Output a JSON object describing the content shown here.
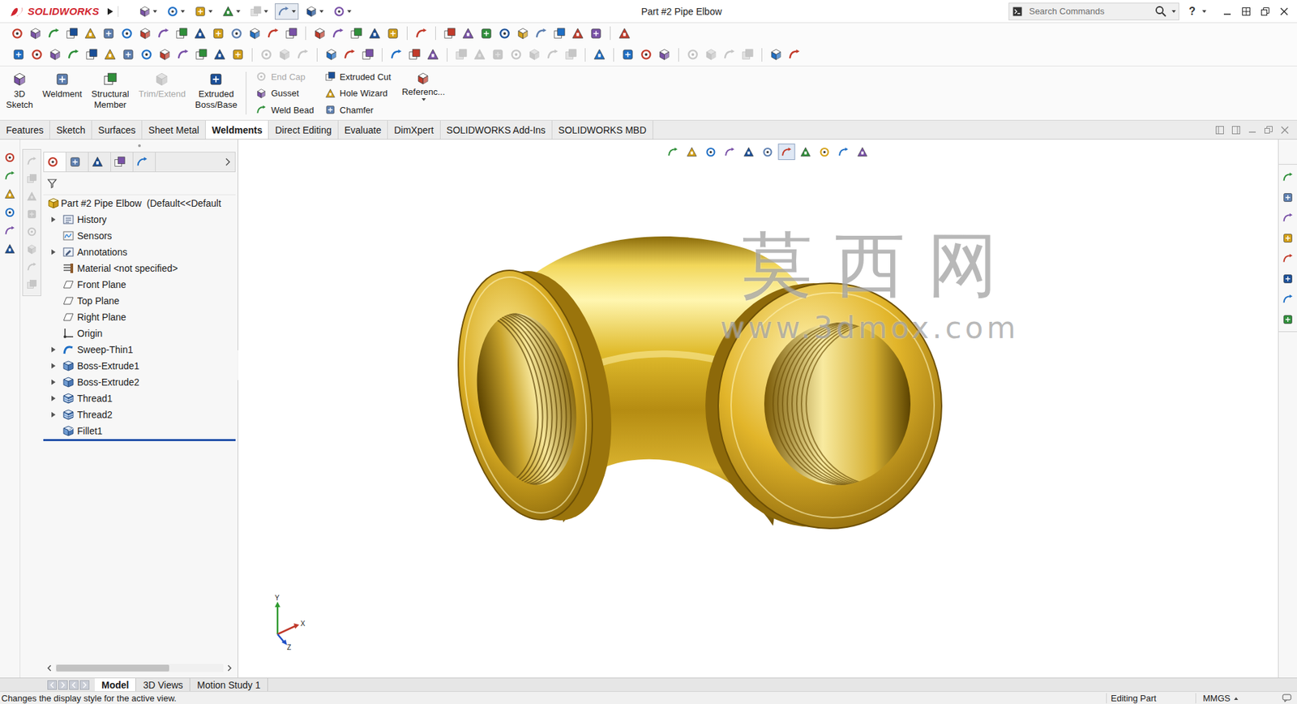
{
  "window": {
    "title": "Part #2 Pipe Elbow",
    "logo": "SOLIDWORKS"
  },
  "search": {
    "placeholder": "Search Commands"
  },
  "help": "?",
  "quick_access": [
    {
      "disabled": false,
      "selected": false
    },
    {
      "disabled": false,
      "selected": false
    },
    {
      "disabled": false,
      "selected": false
    },
    {
      "disabled": false,
      "selected": false
    },
    {
      "disabled": true,
      "selected": false
    },
    {
      "disabled": false,
      "selected": true
    },
    {
      "disabled": false,
      "selected": false
    },
    {
      "disabled": false,
      "selected": false
    }
  ],
  "toolbar_rows": [
    {
      "groups": [
        {
          "disabled": false
        },
        {
          "disabled": false
        },
        {
          "disabled": false
        },
        {
          "disabled": false
        },
        {
          "disabled": false
        }
      ]
    },
    {
      "groups": [
        {
          "disabled": false
        },
        {
          "disabled": true
        },
        {
          "disabled": false
        },
        {
          "disabled": false
        },
        {
          "disabled": true
        },
        {
          "disabled": false
        },
        {
          "disabled": false
        },
        {
          "disabled": true
        },
        {
          "disabled": false
        }
      ]
    }
  ],
  "command_manager": {
    "large": [
      {
        "lines": [
          "3D",
          "Sketch"
        ],
        "disabled": false
      },
      {
        "lines": [
          "Weldment"
        ],
        "disabled": false
      },
      {
        "lines": [
          "Structural",
          "Member"
        ],
        "disabled": false
      },
      {
        "lines": [
          "Trim/Extend"
        ],
        "disabled": true
      },
      {
        "lines": [
          "Extruded",
          "Boss/Base"
        ],
        "disabled": false
      }
    ],
    "small_columns": [
      [
        {
          "label": "End Cap",
          "disabled": true
        },
        {
          "label": "Gusset",
          "disabled": false
        },
        {
          "label": "Weld Bead",
          "disabled": false
        }
      ],
      [
        {
          "label": "Extruded Cut",
          "disabled": false
        },
        {
          "label": "Hole Wizard",
          "disabled": false
        },
        {
          "label": "Chamfer",
          "disabled": false
        }
      ]
    ],
    "reference": {
      "label": "Referenc..."
    }
  },
  "tabs": [
    {
      "label": "Features",
      "selected": false
    },
    {
      "label": "Sketch",
      "selected": false
    },
    {
      "label": "Surfaces",
      "selected": false
    },
    {
      "label": "Sheet Metal",
      "selected": false
    },
    {
      "label": "Weldments",
      "selected": true
    },
    {
      "label": "Direct Editing",
      "selected": false
    },
    {
      "label": "Evaluate",
      "selected": false
    },
    {
      "label": "DimXpert",
      "selected": false
    },
    {
      "label": "SOLIDWORKS Add-Ins",
      "selected": false
    },
    {
      "label": "SOLIDWORKS MBD",
      "selected": false
    }
  ],
  "left_strip": {
    "primary": [
      {
        "disabled": false
      },
      {
        "disabled": false
      },
      {
        "disabled": false
      },
      {
        "disabled": false
      },
      {
        "disabled": false
      },
      {
        "disabled": false
      }
    ],
    "secondary": [
      {
        "disabled": true
      },
      {
        "disabled": true
      },
      {
        "disabled": true
      },
      {
        "disabled": true
      },
      {
        "disabled": true
      },
      {
        "disabled": true
      },
      {
        "disabled": true
      },
      {
        "disabled": true
      }
    ]
  },
  "feature_tabs": [
    {
      "selected": true
    },
    {
      "selected": false
    },
    {
      "selected": false
    },
    {
      "selected": false
    },
    {
      "selected": false
    }
  ],
  "feature_tree": {
    "root": "Part #2 Pipe Elbow  (Default<<Default",
    "items": [
      {
        "label": "History",
        "kind": "history",
        "expandable": true,
        "rollback": false
      },
      {
        "label": "Sensors",
        "kind": "sensor",
        "expandable": false,
        "rollback": false
      },
      {
        "label": "Annotations",
        "kind": "annotation",
        "expandable": true,
        "rollback": false
      },
      {
        "label": "Material <not specified>",
        "kind": "material",
        "expandable": false,
        "rollback": false
      },
      {
        "label": "Front Plane",
        "kind": "plane",
        "expandable": false,
        "rollback": false
      },
      {
        "label": "Top Plane",
        "kind": "plane",
        "expandable": false,
        "rollback": false
      },
      {
        "label": "Right Plane",
        "kind": "plane",
        "expandable": false,
        "rollback": false
      },
      {
        "label": "Origin",
        "kind": "origin",
        "expandable": false,
        "rollback": false
      },
      {
        "label": "Sweep-Thin1",
        "kind": "sweep",
        "expandable": true,
        "rollback": false
      },
      {
        "label": "Boss-Extrude1",
        "kind": "extrude",
        "expandable": true,
        "rollback": false
      },
      {
        "label": "Boss-Extrude2",
        "kind": "extrude",
        "expandable": true,
        "rollback": false
      },
      {
        "label": "Thread1",
        "kind": "thread",
        "expandable": true,
        "rollback": false
      },
      {
        "label": "Thread2",
        "kind": "thread",
        "expandable": true,
        "rollback": false
      },
      {
        "label": "Fillet1",
        "kind": "fillet",
        "expandable": false,
        "rollback": true
      }
    ]
  },
  "tree_scrollbar": {
    "level": 0.68
  },
  "view_toolbar": [
    {
      "selected": false
    },
    {
      "selected": false
    },
    {
      "selected": false
    },
    {
      "selected": false
    },
    {
      "selected": false
    },
    {
      "selected": false
    },
    {
      "selected": true
    },
    {
      "selected": false
    },
    {
      "selected": false
    },
    {
      "selected": false
    },
    {
      "selected": false
    }
  ],
  "watermark": {
    "title": "莫 西 网",
    "url": "www.3dmox.com"
  },
  "triad": {
    "x": "X",
    "y": "Y",
    "z": "Z"
  },
  "bottom_tabs": [
    {
      "label": "Model",
      "selected": true
    },
    {
      "label": "3D Views",
      "selected": false
    },
    {
      "label": "Motion Study 1",
      "selected": false
    }
  ],
  "status_bar": {
    "message": "Changes the display style for the active view.",
    "mode": "Editing Part",
    "units": "MMGS"
  }
}
